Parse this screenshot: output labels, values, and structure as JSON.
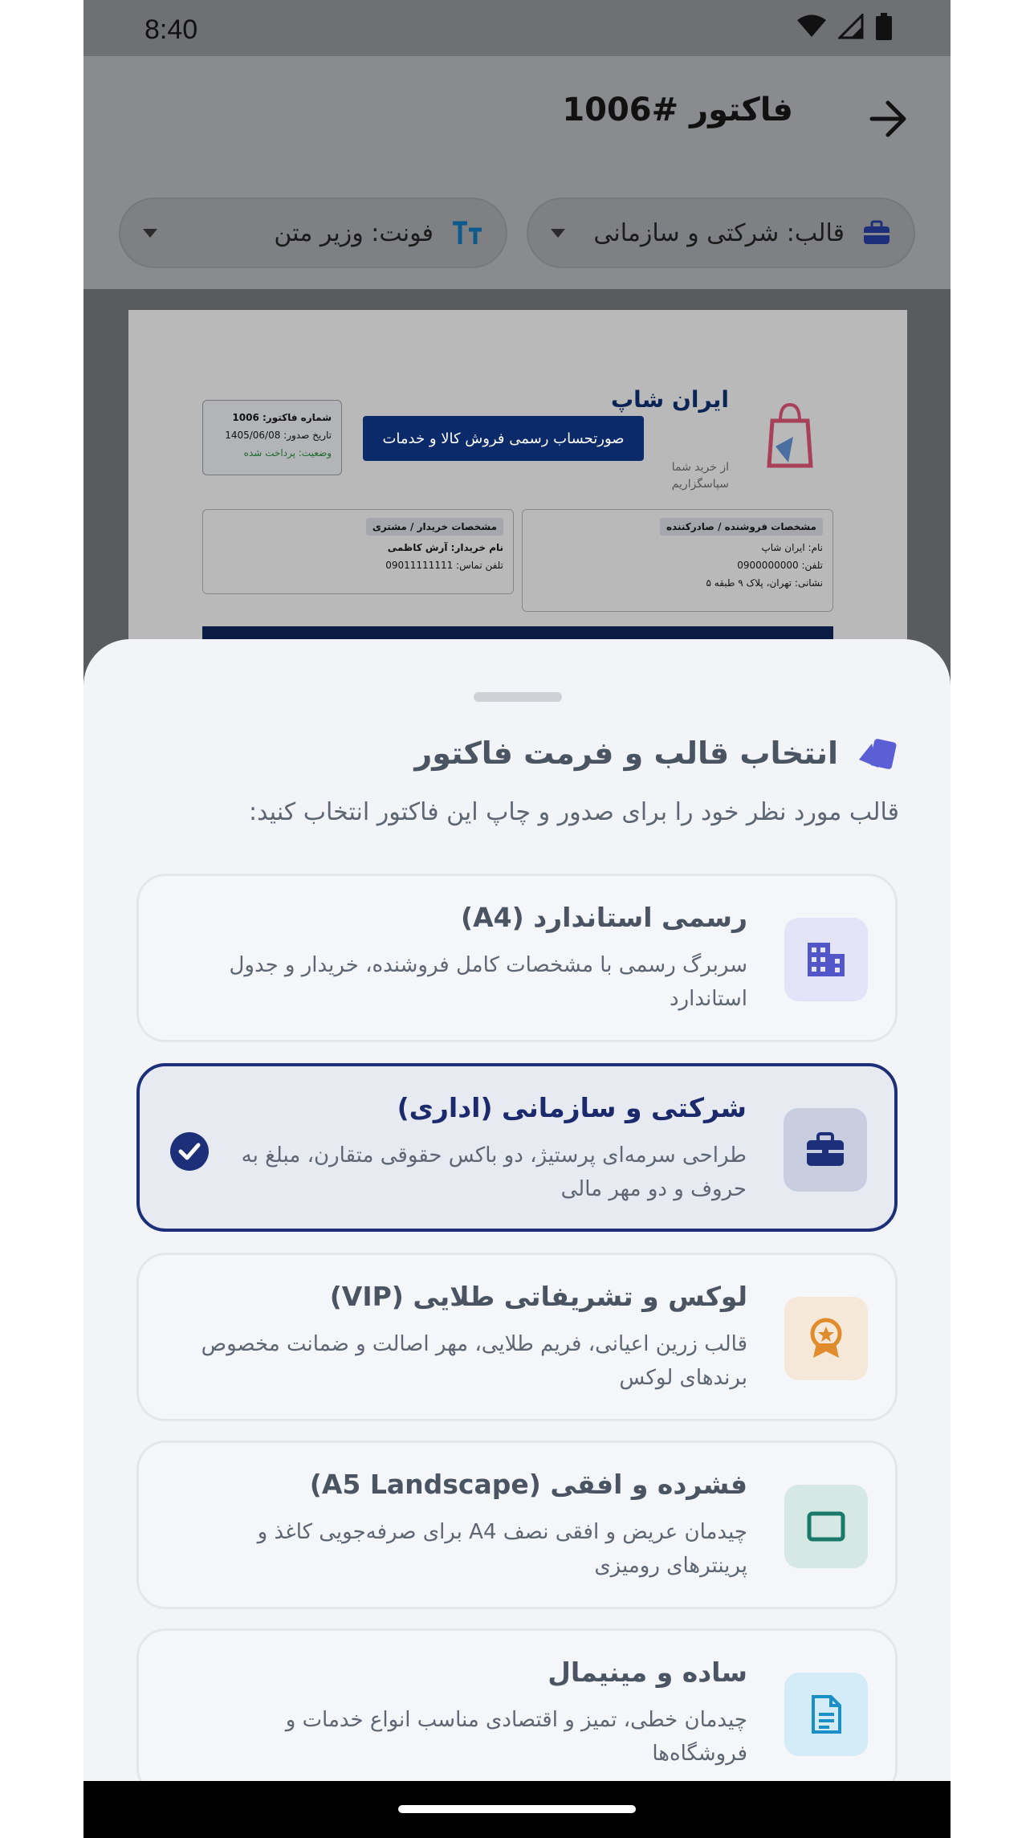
{
  "status_bar": {
    "time": "8:40"
  },
  "header": {
    "title": "فاکتور #1006"
  },
  "chips": {
    "template": "قالب: شرکتی و سازمانی",
    "font": "فونت: وزیر متن"
  },
  "preview": {
    "brand_name": "ایران شاپ",
    "brand_tagline": "از خرید شما سپاسگزاریم",
    "banner": "صورتحساب رسمی فروش کالا و خدمات",
    "invoice_number": "شماره فاکتور: 1006",
    "issue_date": "تاریخ صدور: 1405/06/08",
    "status": "وضعیت: پرداخت شده",
    "seller_title": "مشخصات فروشنده / صادرکننده",
    "seller_name": "نام: ایران شاپ",
    "seller_phone": "تلفن: 0900000000",
    "seller_address": "نشانی: تهران، پلاک ۹ طبقه ۵",
    "buyer_title": "مشخصات خریدار / مشتری",
    "buyer_name": "نام خریدار: آرش کاظمی",
    "buyer_phone": "تلفن تماس: 09011111111"
  },
  "sheet": {
    "title": "انتخاب قالب و فرمت فاکتور",
    "subtitle": "قالب مورد نظر خود را برای صدور و چاپ این فاکتور انتخاب کنید:",
    "options": [
      {
        "title": "رسمی استاندارد (A4)",
        "desc": "سربرگ رسمی با مشخصات کامل فروشنده، خریدار و جدول استاندارد",
        "icon": "building-icon",
        "selected": false
      },
      {
        "title": "شرکتی و سازمانی (اداری)",
        "desc": "طراحی سرمه‌ای پرستیژ، دو باکس حقوقی متقارن، مبلغ به حروف و دو مهر مالی",
        "icon": "briefcase-icon",
        "selected": true
      },
      {
        "title": "لوکس و تشریفاتی طلایی (VIP)",
        "desc": "قالب زرین اعیانی، فریم طلایی، مهر اصالت و ضمانت مخصوص برندهای لوکس",
        "icon": "award-icon",
        "selected": false
      },
      {
        "title": "فشرده و افقی (A5 Landscape)",
        "desc": "چیدمان عریض و افقی نصف A4 برای صرفه‌جویی کاغذ و پرینترهای رومیزی",
        "icon": "landscape-icon",
        "selected": false
      },
      {
        "title": "ساده و مینیمال",
        "desc": "چیدمان خطی، تمیز و اقتصادی مناسب انواع خدمات و فروشگاه‌ها",
        "icon": "document-icon",
        "selected": false
      }
    ]
  },
  "colors": {
    "primary": "#1c2f78",
    "sheet_bg": "#f3f4f8",
    "text_muted": "#5e6673"
  }
}
